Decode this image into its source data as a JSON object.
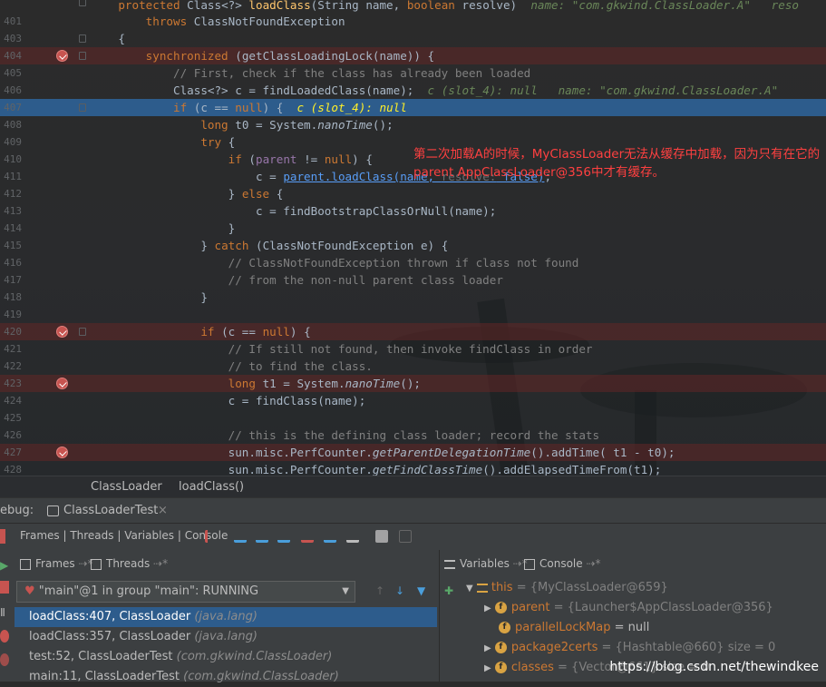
{
  "editor": {
    "lines": [
      {
        "num": "",
        "text": "    protected Class<?> loadClass(String name, boolean resolve)"
      },
      {
        "num": "401",
        "text": "        throws ClassNotFoundException"
      },
      {
        "num": "403",
        "text": "    {"
      },
      {
        "num": "404",
        "text": "        synchronized (getClassLoadingLock(name)) {"
      },
      {
        "num": "405",
        "text": "            // First, check if the class has already been loaded"
      },
      {
        "num": "406",
        "text": "            Class<?> c = findLoadedClass(name);"
      },
      {
        "num": "407",
        "text": "            if (c == null) {"
      },
      {
        "num": "408",
        "text": "                long t0 = System.nanoTime();"
      },
      {
        "num": "409",
        "text": "                try {"
      },
      {
        "num": "410",
        "text": "                    if (parent != null) {"
      },
      {
        "num": "411",
        "text": "                        c = parent.loadClass(name, resolve: false);"
      },
      {
        "num": "412",
        "text": "                    } else {"
      },
      {
        "num": "413",
        "text": "                        c = findBootstrapClassOrNull(name);"
      },
      {
        "num": "414",
        "text": "                    }"
      },
      {
        "num": "415",
        "text": "                } catch (ClassNotFoundException e) {"
      },
      {
        "num": "416",
        "text": "                    // ClassNotFoundException thrown if class not found"
      },
      {
        "num": "417",
        "text": "                    // from the non-null parent class loader"
      },
      {
        "num": "418",
        "text": "                }"
      },
      {
        "num": "419",
        "text": ""
      },
      {
        "num": "420",
        "text": "                if (c == null) {"
      },
      {
        "num": "421",
        "text": "                    // If still not found, then invoke findClass in order"
      },
      {
        "num": "422",
        "text": "                    // to find the class."
      },
      {
        "num": "423",
        "text": "                    long t1 = System.nanoTime();"
      },
      {
        "num": "424",
        "text": "                    c = findClass(name);"
      },
      {
        "num": "425",
        "text": ""
      },
      {
        "num": "426",
        "text": "                    // this is the defining class loader; record the stats"
      },
      {
        "num": "427",
        "text": "                    sun.misc.PerfCounter.getParentDelegationTime().addTime( t1 - t0);"
      },
      {
        "num": "428",
        "text": "                    sun.misc.PerfCounter.getFindClassTime().addElapsedTimeFrom(t1);"
      }
    ],
    "inline_hints": {
      "l400": "name: \"com.gkwind.ClassLoader.A\"   reso",
      "l406": "c (slot_4): null   name: \"com.gkwind.ClassLoader.A\"",
      "l407": "c (slot_4): null"
    },
    "annotation": "第二次加载A的时候，MyClassLoader无法从缓存中加载，因为只有在它的parent AppClassLoader@356中才有缓存。"
  },
  "breadcrumb": {
    "class": "ClassLoader",
    "method": "loadClass()"
  },
  "debug": {
    "label": "ebug:",
    "tab": "ClassLoaderTest"
  },
  "toolbar": {
    "tabs": "Frames | Threads | Variables | Console"
  },
  "panels": {
    "frames_tab": "Frames",
    "threads_tab": "Threads",
    "thread_select": "\"main\"@1 in group \"main\": RUNNING",
    "frames": [
      {
        "loc": "loadClass:407, ClassLoader",
        "pkg": "(java.lang)"
      },
      {
        "loc": "loadClass:357, ClassLoader",
        "pkg": "(java.lang)"
      },
      {
        "loc": "test:52, ClassLoaderTest",
        "pkg": "(com.gkwind.ClassLoader)"
      },
      {
        "loc": "main:11, ClassLoaderTest",
        "pkg": "(com.gkwind.ClassLoader)"
      }
    ],
    "variables_tab": "Variables",
    "console_tab": "Console",
    "vars": [
      {
        "name": "this",
        "value": "= {MyClassLoader@659}"
      },
      {
        "name": "parent",
        "value": "= {Launcher$AppClassLoader@356}"
      },
      {
        "name": "parallelLockMap",
        "value": "= null"
      },
      {
        "name": "package2certs",
        "value": "= {Hashtable@660}  size = 0"
      },
      {
        "name": "classes",
        "value": "= {Vector@661}  size = 0"
      }
    ]
  },
  "watermark": "https://blog.csdn.net/thewindkee"
}
